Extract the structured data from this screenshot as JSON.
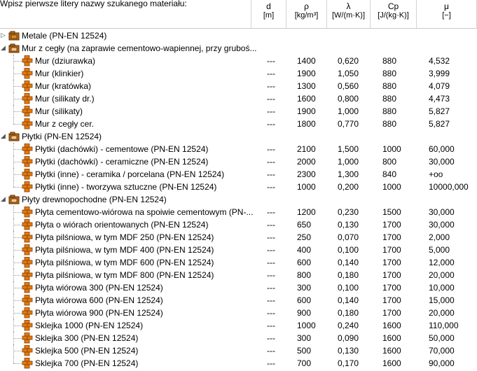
{
  "header": {
    "search_label": "Wpisz pierwsze litery nazwy szukanego materiału:",
    "search_value": "",
    "columns": [
      {
        "symbol": "d",
        "unit": "[m]"
      },
      {
        "symbol": "ρ",
        "unit": "[kg/m³]"
      },
      {
        "symbol": "λ",
        "unit": "[W/(m·K)]"
      },
      {
        "symbol": "Cp",
        "unit": "[J/(kg·K)]"
      },
      {
        "symbol": "μ",
        "unit": "[−]"
      }
    ]
  },
  "tree": [
    {
      "type": "group",
      "label": "Metale (PN-EN 12524)",
      "expanded": false,
      "icon": "group-icon-collapsed"
    },
    {
      "type": "group",
      "label": "Mur z cegły (na zaprawie cementowo-wapiennej, przy gruboś...",
      "expanded": true,
      "icon": "group-icon-open"
    },
    {
      "type": "item",
      "label": "Mur (dziurawka)",
      "d": "---",
      "rho": "1400",
      "lambda": "0,620",
      "cp": "880",
      "mu": "4,532"
    },
    {
      "type": "item",
      "label": "Mur (klinkier)",
      "d": "---",
      "rho": "1900",
      "lambda": "1,050",
      "cp": "880",
      "mu": "3,999"
    },
    {
      "type": "item",
      "label": "Mur (kratówka)",
      "d": "---",
      "rho": "1300",
      "lambda": "0,560",
      "cp": "880",
      "mu": "4,079"
    },
    {
      "type": "item",
      "label": "Mur (silikaty dr.)",
      "d": "---",
      "rho": "1600",
      "lambda": "0,800",
      "cp": "880",
      "mu": "4,473"
    },
    {
      "type": "item",
      "label": "Mur (silikaty)",
      "d": "---",
      "rho": "1900",
      "lambda": "1,000",
      "cp": "880",
      "mu": "5,827"
    },
    {
      "type": "item",
      "label": "Mur z cegły cer.",
      "d": "---",
      "rho": "1800",
      "lambda": "0,770",
      "cp": "880",
      "mu": "5,827"
    },
    {
      "type": "group",
      "label": "Płytki (PN-EN 12524)",
      "expanded": true,
      "icon": "group-icon-open"
    },
    {
      "type": "item",
      "label": "Płytki (dachówki) - cementowe (PN-EN 12524)",
      "d": "---",
      "rho": "2100",
      "lambda": "1,500",
      "cp": "1000",
      "mu": "60,000"
    },
    {
      "type": "item",
      "label": "Płytki (dachówki) - ceramiczne (PN-EN 12524)",
      "d": "---",
      "rho": "2000",
      "lambda": "1,000",
      "cp": "800",
      "mu": "30,000"
    },
    {
      "type": "item",
      "label": "Płytki (inne) - ceramika / porcelana (PN-EN 12524)",
      "d": "---",
      "rho": "2300",
      "lambda": "1,300",
      "cp": "840",
      "mu": "+oo"
    },
    {
      "type": "item",
      "label": "Płytki (inne) - tworzywa sztuczne (PN-EN 12524)",
      "d": "---",
      "rho": "1000",
      "lambda": "0,200",
      "cp": "1000",
      "mu": "10000,000"
    },
    {
      "type": "group",
      "label": "Płyty drewnopochodne (PN-EN 12524)",
      "expanded": true,
      "icon": "group-icon-open"
    },
    {
      "type": "item",
      "label": "Płyta cementowo-wiórowa na spoiwie cementowym (PN-...",
      "d": "---",
      "rho": "1200",
      "lambda": "0,230",
      "cp": "1500",
      "mu": "30,000"
    },
    {
      "type": "item",
      "label": "Płyta o wiórach orientowanych (PN-EN 12524)",
      "d": "---",
      "rho": "650",
      "lambda": "0,130",
      "cp": "1700",
      "mu": "30,000"
    },
    {
      "type": "item",
      "label": "Płyta pilśniowa, w tym MDF 250 (PN-EN 12524)",
      "d": "---",
      "rho": "250",
      "lambda": "0,070",
      "cp": "1700",
      "mu": "2,000"
    },
    {
      "type": "item",
      "label": "Płyta pilśniowa, w tym MDF 400 (PN-EN 12524)",
      "d": "---",
      "rho": "400",
      "lambda": "0,100",
      "cp": "1700",
      "mu": "5,000"
    },
    {
      "type": "item",
      "label": "Płyta pilśniowa, w tym MDF 600 (PN-EN 12524)",
      "d": "---",
      "rho": "600",
      "lambda": "0,140",
      "cp": "1700",
      "mu": "12,000"
    },
    {
      "type": "item",
      "label": "Płyta pilśniowa, w tym MDF 800 (PN-EN 12524)",
      "d": "---",
      "rho": "800",
      "lambda": "0,180",
      "cp": "1700",
      "mu": "20,000"
    },
    {
      "type": "item",
      "label": "Płyta wiórowa 300 (PN-EN 12524)",
      "d": "---",
      "rho": "300",
      "lambda": "0,100",
      "cp": "1700",
      "mu": "10,000"
    },
    {
      "type": "item",
      "label": "Płyta wiórowa 600 (PN-EN 12524)",
      "d": "---",
      "rho": "600",
      "lambda": "0,140",
      "cp": "1700",
      "mu": "15,000"
    },
    {
      "type": "item",
      "label": "Płyta wiórowa 900 (PN-EN 12524)",
      "d": "---",
      "rho": "900",
      "lambda": "0,180",
      "cp": "1700",
      "mu": "20,000"
    },
    {
      "type": "item",
      "label": "Sklejka 1000 (PN-EN 12524)",
      "d": "---",
      "rho": "1000",
      "lambda": "0,240",
      "cp": "1600",
      "mu": "110,000"
    },
    {
      "type": "item",
      "label": "Sklejka 300 (PN-EN 12524)",
      "d": "---",
      "rho": "300",
      "lambda": "0,090",
      "cp": "1600",
      "mu": "50,000"
    },
    {
      "type": "item",
      "label": "Sklejka 500 (PN-EN 12524)",
      "d": "---",
      "rho": "500",
      "lambda": "0,130",
      "cp": "1600",
      "mu": "70,000"
    },
    {
      "type": "item",
      "label": "Sklejka 700 (PN-EN 12524)",
      "d": "---",
      "rho": "700",
      "lambda": "0,170",
      "cp": "1600",
      "mu": "90,000"
    }
  ],
  "colors": {
    "item_icon": "#e07a10",
    "item_icon_dark": "#8a3d00",
    "group_icon": "#b86a1a",
    "tree_line": "#9a9a9a"
  }
}
